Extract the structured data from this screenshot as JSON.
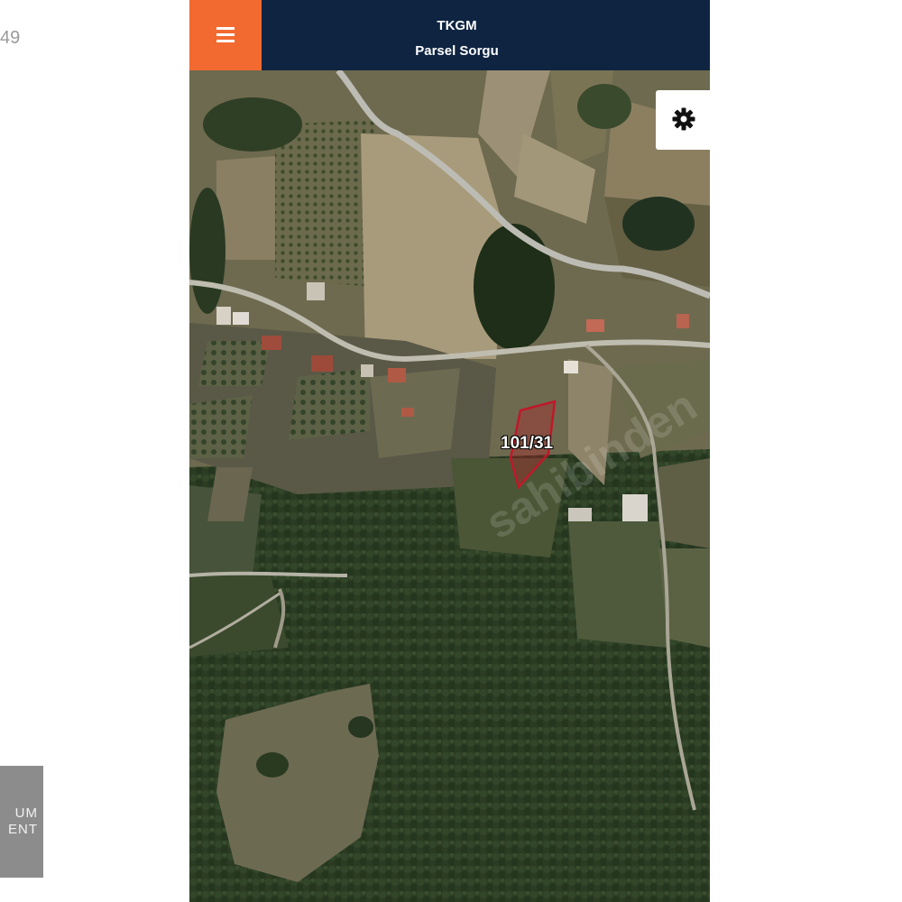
{
  "background": {
    "partial_number": "49",
    "partial_logo_text": "UM\nENT"
  },
  "header": {
    "title": "TKGM",
    "subtitle": "Parsel Sorgu",
    "menu_icon": "hamburger-menu-icon",
    "colors": {
      "bar": "#0e2441",
      "menu_button": "#f26a30",
      "text": "#ffffff"
    }
  },
  "map": {
    "type": "satellite",
    "settings_icon": "gear-icon",
    "parcel": {
      "label": "101/31",
      "outline_color": "#c0182a"
    },
    "watermark": "sahibinden"
  }
}
